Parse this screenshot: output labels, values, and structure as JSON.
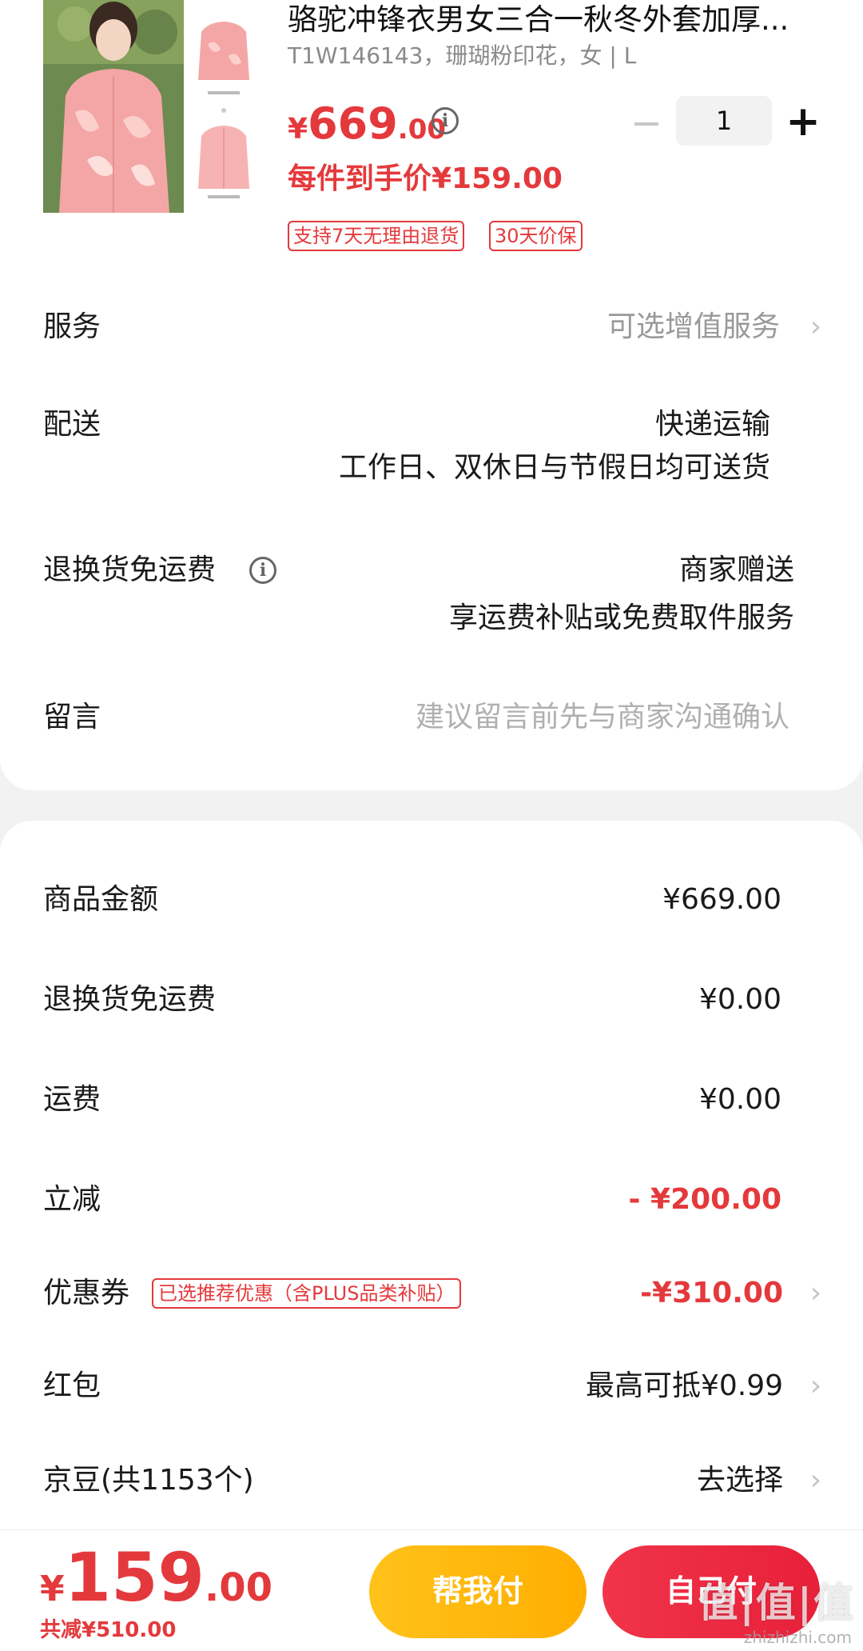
{
  "product": {
    "title": "骆驼冲锋衣男女三合一秋冬外套加厚...",
    "sku": "T1W146143，珊瑚粉印花，女 | L",
    "price_symbol": "¥",
    "price_int": "669",
    "price_dec": ".00",
    "per_price": "每件到手价¥159.00",
    "quantity": "1",
    "tags": [
      "支持7天无理由退货",
      "30天价保"
    ],
    "image_colors": {
      "jacket": "#f4a6a6",
      "jacket_light": "#fbd0cc"
    }
  },
  "rows": {
    "service": {
      "label": "服务",
      "value": "可选增值服务"
    },
    "delivery": {
      "label": "配送",
      "value": "快递运输",
      "value2": "工作日、双休日与节假日均可送货"
    },
    "return_free": {
      "label": "退换货免运费",
      "value": "商家赠送",
      "value2": "享运费补贴或免费取件服务"
    },
    "message": {
      "label": "留言",
      "placeholder": "建议留言前先与商家沟通确认"
    }
  },
  "summary": {
    "goods_amount": {
      "label": "商品金额",
      "value": "¥669.00"
    },
    "return_fee": {
      "label": "退换货免运费",
      "value": "¥0.00"
    },
    "shipping": {
      "label": "运费",
      "value": "¥0.00"
    },
    "discount": {
      "label": "立减",
      "value": "- ¥200.00"
    },
    "coupon": {
      "label": "优惠券",
      "tag": "已选推荐优惠（含PLUS品类补贴）",
      "value": "-¥310.00"
    },
    "red_packet": {
      "label": "红包",
      "value": "最高可抵¥0.99"
    },
    "jingdou": {
      "label": "京豆(共1153个)",
      "value": "去选择"
    }
  },
  "footer": {
    "total_symbol": "¥",
    "total_int": "159",
    "total_dec": ".00",
    "total_saved": "共减¥510.00",
    "help_pay": "帮我付",
    "self_pay": "自己付",
    "watermark": "值|值|值",
    "watermark_url": "zhizhizhi.com"
  },
  "colors": {
    "accent": "#e4393c",
    "help_btn": "#ffb800",
    "self_btn": "#ec2a40"
  },
  "icons": [
    "info-icon",
    "chevron-right-icon",
    "minus-icon",
    "plus-icon"
  ]
}
